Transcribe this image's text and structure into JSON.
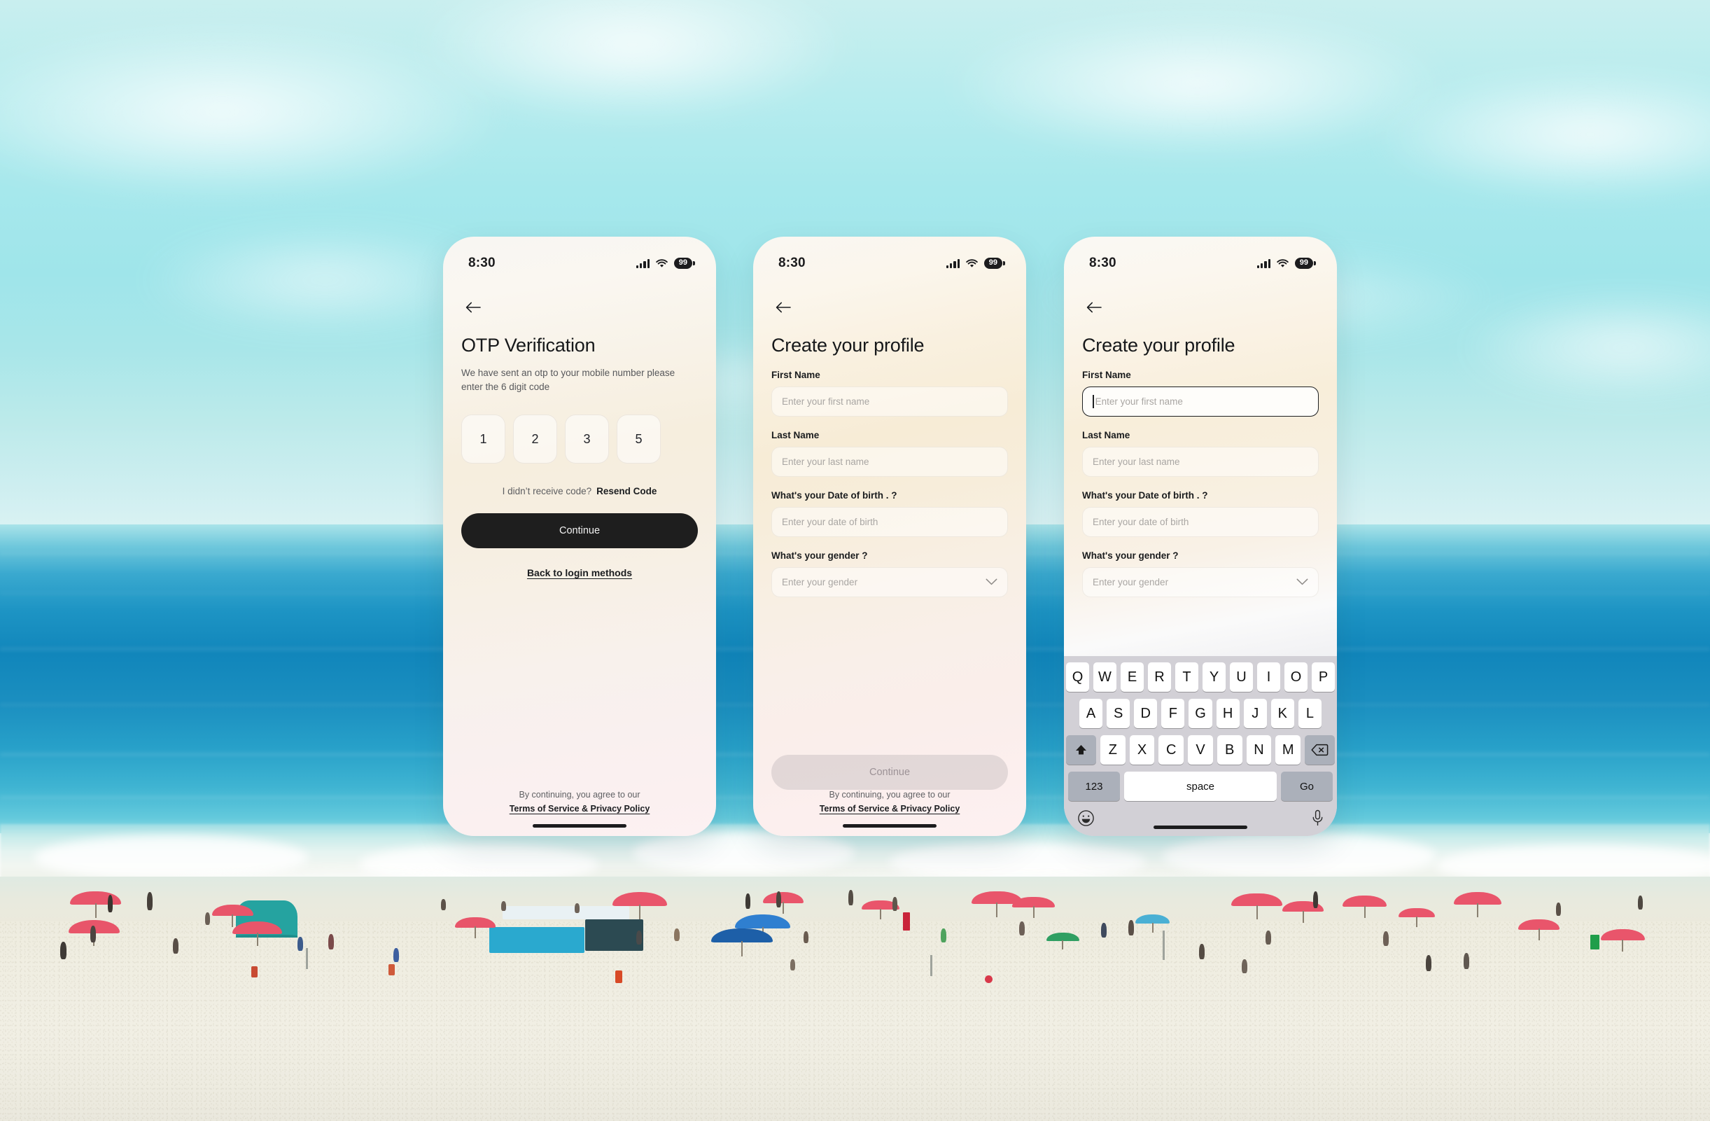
{
  "background": {
    "scene": "beach-photo",
    "sky_color": "#a6e8ec",
    "sea_color": "#1186bb",
    "sand_color": "#f0eee2",
    "surf_color": "#e6f4f1"
  },
  "status_bar": {
    "time": "8:30",
    "battery": "99",
    "signal_icon": "cellular-signal-icon",
    "wifi_icon": "wifi-icon",
    "battery_icon": "battery-icon"
  },
  "icons": {
    "back_arrow": "back-arrow-icon",
    "chevron_down": "chevron-down-icon",
    "shift": "shift-key-icon",
    "backspace": "backspace-key-icon",
    "emoji": "emoji-key-icon",
    "microphone": "microphone-key-icon"
  },
  "footer": {
    "line1": "By continuing, you agree to our",
    "line2": "Terms of Service & Privacy Policy"
  },
  "screens": [
    {
      "id": "otp-verification",
      "title": "OTP Verification",
      "subtitle": "We have sent an otp to your mobile number please enter the 6 digit code",
      "otp_digits": [
        "1",
        "2",
        "3",
        "5"
      ],
      "resend_prompt": "I didn’t receive code?",
      "resend_link": "Resend Code",
      "primary_button": "Continue",
      "primary_button_color": "#1e1e1e",
      "secondary_link": "Back to login methods"
    },
    {
      "id": "create-profile",
      "title": "Create your profile",
      "fields": [
        {
          "label": "First Name",
          "placeholder": "Enter your first name",
          "value": "",
          "type": "text",
          "focused": false
        },
        {
          "label": "Last Name",
          "placeholder": "Enter your last name",
          "value": "",
          "type": "text",
          "focused": false
        },
        {
          "label": "What's your Date of birth . ?",
          "placeholder": "Enter your date of birth",
          "value": "",
          "type": "text",
          "focused": false
        },
        {
          "label": "What's your gender ?",
          "placeholder": "Enter your gender",
          "value": "",
          "type": "select",
          "focused": false
        }
      ],
      "primary_button": "Continue",
      "primary_button_state": "disabled"
    },
    {
      "id": "create-profile-keyboard",
      "title": "Create your profile",
      "fields": [
        {
          "label": "First Name",
          "placeholder": "Enter your first name",
          "value": "",
          "type": "text",
          "focused": true
        },
        {
          "label": "Last Name",
          "placeholder": "Enter your last name",
          "value": "",
          "type": "text",
          "focused": false
        },
        {
          "label": "What's your Date of birth . ?",
          "placeholder": "Enter your date of birth",
          "value": "",
          "type": "text",
          "focused": false
        },
        {
          "label": "What's your gender ?",
          "placeholder": "Enter your gender",
          "value": "",
          "type": "select",
          "focused": false
        }
      ]
    }
  ],
  "keyboard": {
    "row1": [
      "Q",
      "W",
      "E",
      "R",
      "T",
      "Y",
      "U",
      "I",
      "O",
      "P"
    ],
    "row2": [
      "A",
      "S",
      "D",
      "F",
      "G",
      "H",
      "J",
      "K",
      "L"
    ],
    "row3": [
      "Z",
      "X",
      "C",
      "V",
      "B",
      "N",
      "M"
    ],
    "numeric_key": "123",
    "space_key": "space",
    "return_key": "Go"
  }
}
